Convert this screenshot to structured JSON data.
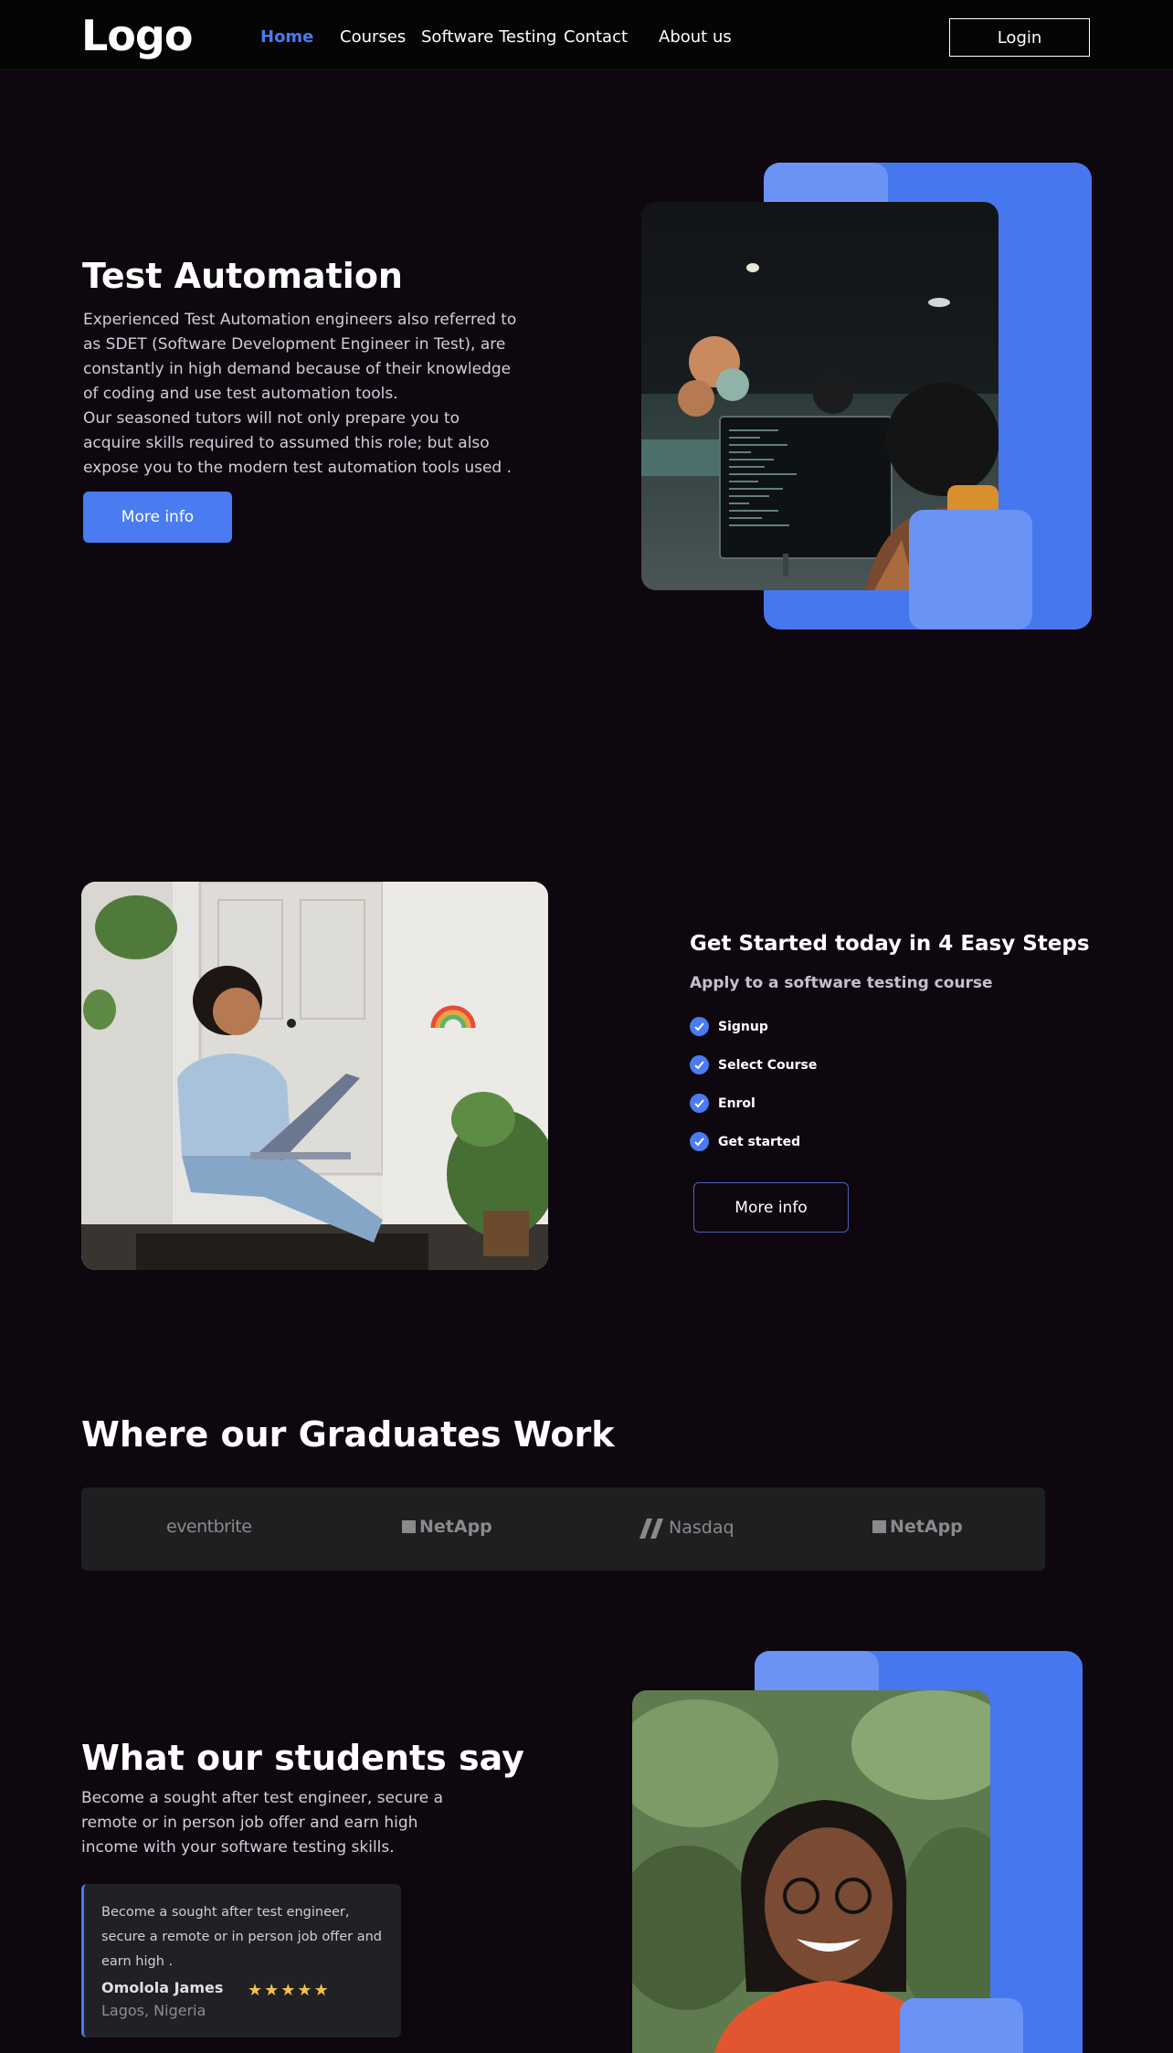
{
  "nav": {
    "logo": "Logo",
    "links": [
      "Home",
      "Courses",
      "Software Testing",
      "Contact",
      "About us"
    ],
    "login": "Login"
  },
  "hero": {
    "title": "Test Automation",
    "paragraph1": "Experienced Test Automation engineers also referred to as SDET (Software Development Engineer in Test), are constantly in high demand because of their knowledge of coding and use test automation tools.",
    "paragraph2": "Our seasoned tutors will not only prepare you to acquire skills required to assumed this role; but also expose you to the modern test automation tools used .",
    "button": "More info"
  },
  "steps": {
    "title": "Get Started today in 4 Easy Steps",
    "subtitle": "Apply to a software testing course",
    "items": [
      "Signup",
      "Select Course",
      "Enrol",
      "Get started"
    ],
    "button": "More info"
  },
  "graduates": {
    "title": "Where our Graduates Work",
    "brands": [
      "eventbrite",
      "NetApp",
      "Nasdaq",
      "NetApp"
    ]
  },
  "testimonials": {
    "title": "What our students say",
    "text": "Become a sought after test engineer, secure a remote or in person job offer and earn high income with your software testing skills.",
    "quote": "Become a sought after test engineer, secure a remote or in person job offer and earn high .",
    "name": "Omolola James",
    "location": "Lagos, Nigeria",
    "rating": 5,
    "stars": "★★★★★"
  },
  "colors": {
    "accent": "#4a7bf0",
    "background": "#0e0710",
    "nav_background": "#050505",
    "star": "#f2c14b"
  }
}
